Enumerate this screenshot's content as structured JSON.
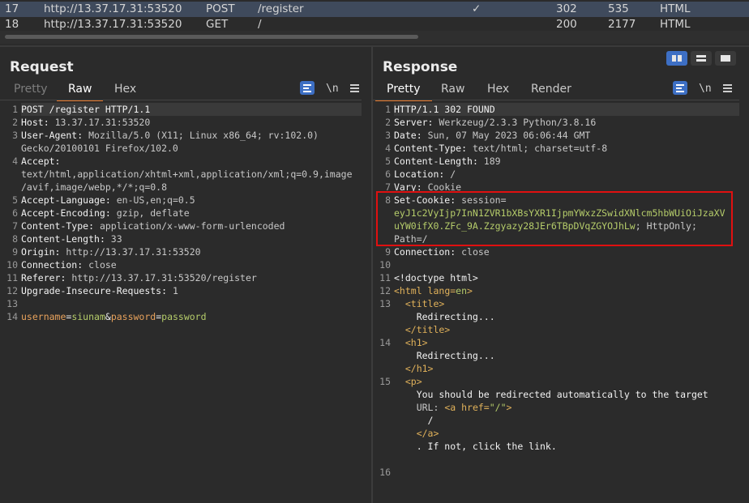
{
  "history": {
    "rows": [
      {
        "num": "17",
        "host": "http://13.37.17.31:53520",
        "method": "POST",
        "url": "/register",
        "edited": "✓",
        "status": "302",
        "length": "535",
        "mime": "HTML",
        "selected": true
      },
      {
        "num": "18",
        "host": "http://13.37.17.31:53520",
        "method": "GET",
        "url": "/",
        "edited": "",
        "status": "200",
        "length": "2177",
        "mime": "HTML",
        "selected": false
      }
    ]
  },
  "request": {
    "title": "Request",
    "tabs": [
      "Pretty",
      "Raw",
      "Hex"
    ],
    "active_tab": "Raw",
    "newline_label": "\\n",
    "lines": [
      {
        "n": "1",
        "text": "POST /register HTTP/1.1"
      },
      {
        "n": "2",
        "key": "Host",
        "val": "13.37.17.31:53520"
      },
      {
        "n": "3",
        "key": "User-Agent",
        "val": "Mozilla/5.0 (X11; Linux x86_64; rv:102.0)"
      },
      {
        "n": "",
        "val": "Gecko/20100101 Firefox/102.0"
      },
      {
        "n": "4",
        "key": "Accept",
        "val": ""
      },
      {
        "n": "",
        "val": "text/html,application/xhtml+xml,application/xml;q=0.9,image"
      },
      {
        "n": "",
        "val": "/avif,image/webp,*/*;q=0.8"
      },
      {
        "n": "5",
        "key": "Accept-Language",
        "val": "en-US,en;q=0.5"
      },
      {
        "n": "6",
        "key": "Accept-Encoding",
        "val": "gzip, deflate"
      },
      {
        "n": "7",
        "key": "Content-Type",
        "val": "application/x-www-form-urlencoded"
      },
      {
        "n": "8",
        "key": "Content-Length",
        "val": "33"
      },
      {
        "n": "9",
        "key": "Origin",
        "val": "http://13.37.17.31:53520"
      },
      {
        "n": "10",
        "key": "Connection",
        "val": "close"
      },
      {
        "n": "11",
        "key": "Referer",
        "val": "http://13.37.17.31:53520/register"
      },
      {
        "n": "12",
        "key": "Upgrade-Insecure-Requests",
        "val": "1"
      },
      {
        "n": "13",
        "text": ""
      },
      {
        "n": "14",
        "body": [
          {
            "c": "o",
            "t": "username"
          },
          {
            "c": "k",
            "t": "="
          },
          {
            "c": "g",
            "t": "siunam"
          },
          {
            "c": "k",
            "t": "&"
          },
          {
            "c": "o",
            "t": "password"
          },
          {
            "c": "k",
            "t": "="
          },
          {
            "c": "g",
            "t": "password"
          }
        ]
      }
    ]
  },
  "response": {
    "title": "Response",
    "tabs": [
      "Pretty",
      "Raw",
      "Hex",
      "Render"
    ],
    "active_tab": "Pretty",
    "newline_label": "\\n",
    "lines": [
      {
        "n": "1",
        "text": "HTTP/1.1 302 FOUND"
      },
      {
        "n": "2",
        "key": "Server",
        "val": "Werkzeug/2.3.3 Python/3.8.16"
      },
      {
        "n": "3",
        "key": "Date",
        "val": "Sun, 07 May 2023 06:06:44 GMT"
      },
      {
        "n": "4",
        "key": "Content-Type",
        "val": "text/html; charset=utf-8"
      },
      {
        "n": "5",
        "key": "Content-Length",
        "val": "189"
      },
      {
        "n": "6",
        "key": "Location",
        "val": "/"
      },
      {
        "n": "7",
        "key": "Vary",
        "val": "Cookie"
      },
      {
        "n": "8",
        "key": "Set-Cookie",
        "val": "session="
      },
      {
        "n": "",
        "green": "eyJ1c2VyIjp7InN1ZVR1bXBsYXR1IjpmYWxzZSwidXNlcm5hbWUiOiJzaXV"
      },
      {
        "n": "",
        "green": "uYW0ifX0.ZFc_9A.Zzgyazy28JEr6TBpDVqZGYOJhLw",
        "rest": "; HttpOnly;"
      },
      {
        "n": "",
        "val": "Path=/"
      },
      {
        "n": "9",
        "key": "Connection",
        "val": "close"
      },
      {
        "n": "10",
        "text": ""
      },
      {
        "n": "11",
        "text": "<!doctype html>"
      },
      {
        "n": "12",
        "html": [
          {
            "c": "t",
            "t": "<html "
          },
          {
            "c": "a",
            "t": "lang="
          },
          {
            "c": "g",
            "t": "en"
          },
          {
            "c": "t",
            "t": ">"
          }
        ]
      },
      {
        "n": "13",
        "html": [
          {
            "c": "t",
            "t": "  <title>"
          }
        ]
      },
      {
        "n": "",
        "text": "    Redirecting..."
      },
      {
        "n": "",
        "html": [
          {
            "c": "t",
            "t": "  </title>"
          }
        ]
      },
      {
        "n": "14",
        "html": [
          {
            "c": "t",
            "t": "  <h1>"
          }
        ]
      },
      {
        "n": "",
        "text": "    Redirecting..."
      },
      {
        "n": "",
        "html": [
          {
            "c": "t",
            "t": "  </h1>"
          }
        ]
      },
      {
        "n": "15",
        "html": [
          {
            "c": "t",
            "t": "  <p>"
          }
        ]
      },
      {
        "n": "",
        "text": "    You should be redirected automatically to the target"
      },
      {
        "n": "",
        "html": [
          {
            "c": "v",
            "t": "    URL: "
          },
          {
            "c": "t",
            "t": "<a "
          },
          {
            "c": "a",
            "t": "href="
          },
          {
            "c": "g",
            "t": "\"/\""
          },
          {
            "c": "t",
            "t": ">"
          }
        ]
      },
      {
        "n": "",
        "text": "      /"
      },
      {
        "n": "",
        "html": [
          {
            "c": "t",
            "t": "    </a>"
          }
        ]
      },
      {
        "n": "",
        "text": "    . If not, click the link."
      },
      {
        "n": "",
        "text": ""
      },
      {
        "n": "16",
        "text": ""
      }
    ]
  }
}
